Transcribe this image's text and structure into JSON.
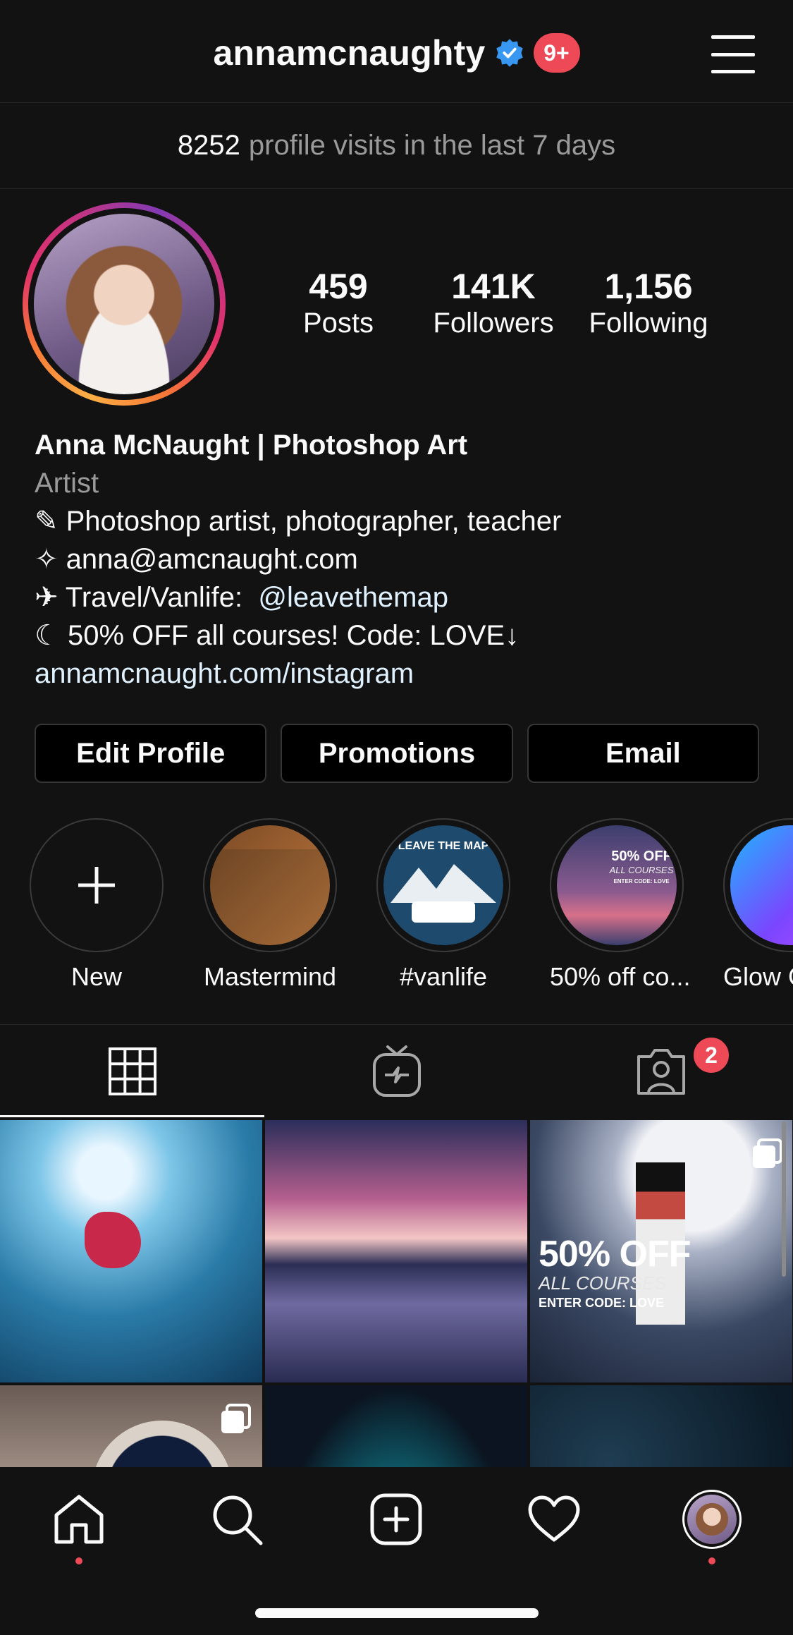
{
  "header": {
    "username": "annamcnaughty",
    "notification_badge": "9+",
    "icons": {
      "verified": "verified-badge-icon",
      "menu": "hamburger-menu-icon"
    }
  },
  "visits": {
    "count": "8252",
    "text": "profile visits in the last 7 days"
  },
  "stats": [
    {
      "value": "459",
      "label": "Posts"
    },
    {
      "value": "141K",
      "label": "Followers"
    },
    {
      "value": "1,156",
      "label": "Following"
    }
  ],
  "bio": {
    "name": "Anna McNaught | Photoshop Art",
    "category": "Artist",
    "lines": [
      "✎ Photoshop artist, photographer, teacher",
      "✧  anna@amcnaught.com",
      "✈ Travel/Vanlife:  ",
      "☾  50% OFF all courses! Code: LOVE↓"
    ],
    "mention": "@leavethemap",
    "website": "annamcnaught.com/instagram"
  },
  "buttons": {
    "edit_profile": "Edit Profile",
    "promotions": "Promotions",
    "email": "Email"
  },
  "highlights": [
    {
      "label": "New"
    },
    {
      "label": "Mastermind"
    },
    {
      "label": "#vanlife"
    },
    {
      "label": "50% off co..."
    },
    {
      "label": "Glow C"
    }
  ],
  "tabs": {
    "items": [
      "grid-icon",
      "igtv-icon",
      "tagged-icon"
    ],
    "tagged_badge": "2"
  },
  "grid": {
    "sale_overlay": {
      "big": "50% OFF",
      "mid": "ALL COURSES",
      "small": "ENTER CODE: LOVE"
    },
    "highlight_sale": {
      "line1": "50% OFF",
      "line2": "ALL COURSES",
      "line3": "ENTER CODE: LOVE"
    },
    "highlight_vanlife": "LEAVE THE MAP"
  },
  "bottom_nav": [
    "home-icon",
    "search-icon",
    "new-post-icon",
    "activity-heart-icon",
    "profile-avatar"
  ],
  "colors": {
    "background": "#121212",
    "badge_red": "#ed4956",
    "verified_blue": "#3897f0",
    "divider": "#262626"
  }
}
